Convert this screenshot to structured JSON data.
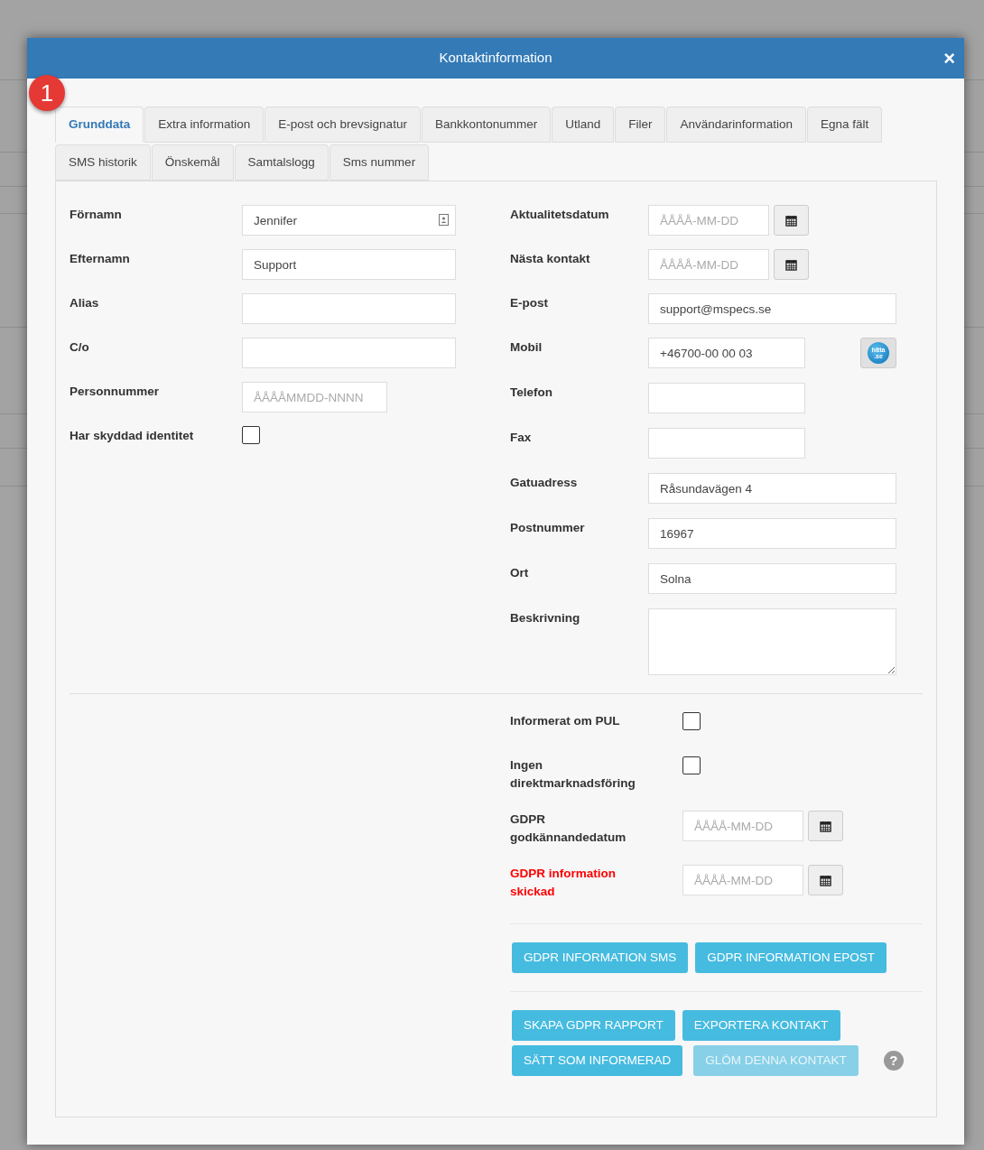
{
  "modal": {
    "title": "Kontaktinformation",
    "close": "×",
    "step_badge": "1",
    "tab_rows": [
      [
        {
          "label": "Grunddata",
          "selected": true
        },
        {
          "label": "Extra information",
          "selected": false
        },
        {
          "label": "E-post och brevsignatur",
          "selected": false
        },
        {
          "label": "Bankkontonummer",
          "selected": false
        },
        {
          "label": "Utland",
          "selected": false
        },
        {
          "label": "Filer",
          "selected": false
        },
        {
          "label": "Användarinformation",
          "selected": false
        },
        {
          "label": "Egna fält",
          "selected": false
        }
      ],
      [
        {
          "label": "SMS historik",
          "selected": false
        },
        {
          "label": "Önskemål",
          "selected": false
        },
        {
          "label": "Samtalslogg",
          "selected": false
        },
        {
          "label": "Sms nummer",
          "selected": false
        }
      ]
    ],
    "left_fields": [
      {
        "label": "Förnamn",
        "kind": "text",
        "value": "Jennifer",
        "contact_icon": true
      },
      {
        "label": "Efternamn",
        "kind": "text",
        "value": "Support"
      },
      {
        "label": "Alias",
        "kind": "text"
      },
      {
        "label": "C/o",
        "kind": "text"
      },
      {
        "label": "Personnummer",
        "kind": "short",
        "placeholder": "ÅÅÅÅMMDD-NNNN"
      },
      {
        "label": "Har skyddad identitet",
        "kind": "checkbox",
        "checked": false
      }
    ],
    "right_fields": [
      {
        "label": "Aktualitetsdatum",
        "kind": "date",
        "placeholder": "ÅÅÅÅ-MM-DD"
      },
      {
        "label": "Nästa kontakt",
        "kind": "date",
        "placeholder": "ÅÅÅÅ-MM-DD"
      },
      {
        "label": "E-post",
        "kind": "text",
        "value": "support@mspecs.se"
      },
      {
        "label": "Mobil",
        "kind": "phone",
        "value": "+46700-00 00 03",
        "lookup": {
          "top": "hitta",
          "bottom": ".se"
        }
      },
      {
        "label": "Telefon",
        "kind": "short"
      },
      {
        "label": "Fax",
        "kind": "short"
      },
      {
        "label": "Gatuadress",
        "kind": "text",
        "value": "Råsundavägen 4"
      },
      {
        "label": "Postnummer",
        "kind": "text",
        "value": "16967"
      },
      {
        "label": "Ort",
        "kind": "text",
        "value": "Solna"
      },
      {
        "label": "Beskrivning",
        "kind": "textarea"
      }
    ],
    "consent": [
      {
        "label": "Informerat om PUL",
        "kind": "checkbox",
        "checked": false,
        "warning": false
      },
      {
        "label": "Ingen direktmarknadsföring",
        "kind": "checkbox",
        "checked": false,
        "warning": false
      },
      {
        "label": "GDPR godkännandedatum",
        "kind": "date",
        "placeholder": "ÅÅÅÅ-MM-DD",
        "warning": false
      },
      {
        "label": "GDPR information skickad",
        "kind": "date",
        "placeholder": "ÅÅÅÅ-MM-DD",
        "warning": true
      }
    ],
    "button_groups": [
      [
        {
          "label": "GDPR INFORMATION SMS",
          "disabled": false
        },
        {
          "label": "GDPR INFORMATION EPOST",
          "disabled": false
        }
      ],
      [
        {
          "label": "SKAPA GDPR RAPPORT",
          "disabled": false
        },
        {
          "label": "EXPORTERA KONTAKT",
          "disabled": false
        },
        {
          "label": "SÄTT SOM INFORMERAD",
          "disabled": false
        },
        {
          "label": "GLÖM DENNA KONTAKT",
          "disabled": true
        }
      ]
    ],
    "help": "?"
  }
}
